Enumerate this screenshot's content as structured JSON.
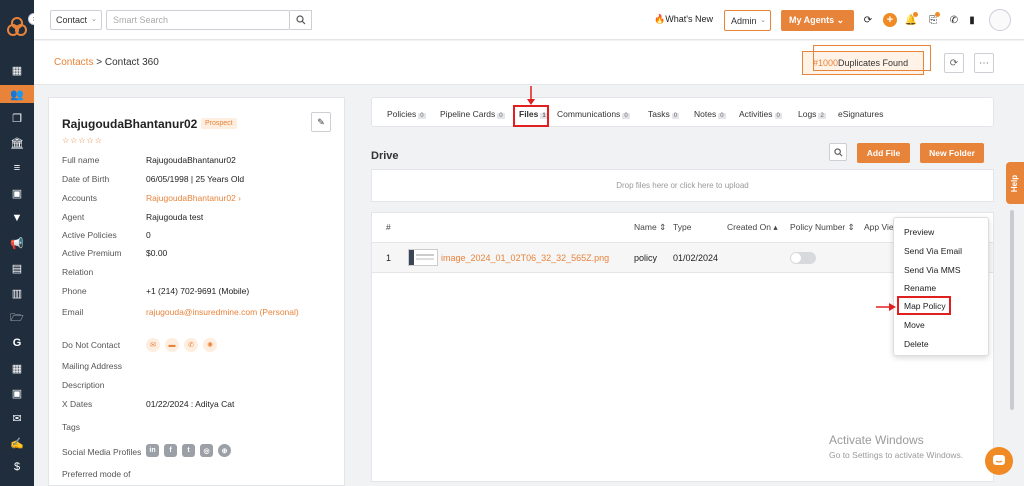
{
  "topbar": {
    "contact_select": "Contact",
    "search_placeholder": "Smart Search",
    "whats_new": "What's New",
    "admin_select": "Admin",
    "my_agents": "My Agents"
  },
  "breadcrumb": {
    "parent": "Contacts",
    "separator": " > ",
    "current": "Contact 360"
  },
  "duplicates": {
    "count": "#1000",
    "label": "Duplicates Found"
  },
  "contact": {
    "name": "RajugoudaBhantanur02",
    "status": "Prospect",
    "stars": "☆☆☆☆☆",
    "fields": [
      {
        "label": "Full name",
        "value": "RajugoudaBhantanur02"
      },
      {
        "label": "Date of Birth",
        "value": "06/05/1998 | 25 Years Old"
      },
      {
        "label": "Accounts",
        "value": "RajugoudaBhantanur02 ›"
      },
      {
        "label": "Agent",
        "value": "Rajugouda test"
      },
      {
        "label": "Active Policies",
        "value": "0"
      },
      {
        "label": "Active Premium",
        "value": "$0.00"
      },
      {
        "label": "Relation",
        "value": ""
      },
      {
        "label": "Phone",
        "value": "+1 (214) 702-9691 (Mobile)"
      },
      {
        "label": "Email",
        "value": "rajugouda@insuredmine.com  (Personal)"
      },
      {
        "label": "Do Not Contact",
        "value": ""
      },
      {
        "label": "Mailing Address",
        "value": ""
      },
      {
        "label": "Description",
        "value": ""
      },
      {
        "label": "X Dates",
        "value": "01/22/2024 : Aditya Cat"
      },
      {
        "label": "Tags",
        "value": ""
      },
      {
        "label": "Social Media Profiles",
        "value": ""
      },
      {
        "label": "Preferred mode of",
        "value": ""
      }
    ]
  },
  "tabs": [
    {
      "label": "Policies",
      "count": "0"
    },
    {
      "label": "Pipeline Cards",
      "count": "0"
    },
    {
      "label": "Files",
      "count": "1"
    },
    {
      "label": "Communications",
      "count": "0"
    },
    {
      "label": "Tasks",
      "count": "0"
    },
    {
      "label": "Notes",
      "count": "0"
    },
    {
      "label": "Activities",
      "count": "0"
    },
    {
      "label": "Logs",
      "count": "2"
    },
    {
      "label": "eSignatures",
      "count": ""
    }
  ],
  "drive": {
    "title": "Drive",
    "add_file": "Add File",
    "new_folder": "New Folder",
    "dropzone": "Drop files here or click here to upload"
  },
  "table": {
    "headers": [
      "#",
      "Name",
      "Type",
      "Created On",
      "Policy Number",
      "App Vie"
    ],
    "rows": [
      {
        "num": "1",
        "name": "image_2024_01_02T06_32_32_565Z.png",
        "type": "policy",
        "created": "01/02/2024"
      }
    ]
  },
  "context_menu": [
    "Preview",
    "Send Via Email",
    "Send Via MMS",
    "Rename",
    "Map Policy",
    "Move",
    "Delete"
  ],
  "watermark": {
    "line1": "Activate Windows",
    "line2": "Go to Settings to activate Windows."
  },
  "help_label": "Help",
  "colors": {
    "accent": "#e8833a",
    "rail": "#1f2d3d",
    "highlight": "#e02020"
  }
}
